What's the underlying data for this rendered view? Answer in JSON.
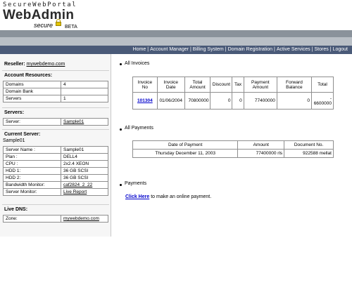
{
  "brand": {
    "top": "SecureWebPortal",
    "title": "WebAdmin",
    "secure": "secure",
    "beta": "BETA"
  },
  "nav": [
    "Home",
    "Account Manager",
    "Billing System",
    "Domain Registration",
    "Active Services",
    "Stores",
    "Logout"
  ],
  "sidebar": {
    "reseller_label": "Reseller:",
    "reseller_link": "mywebdemo.com",
    "resources_title": "Account Resources:",
    "resources": [
      {
        "k": "Domains",
        "v": "4"
      },
      {
        "k": "Domain Bank",
        "v": ""
      },
      {
        "k": "Servers",
        "v": "1"
      }
    ],
    "servers_title": "Servers:",
    "servers_row": {
      "k": "Server:",
      "v": "Sample01"
    },
    "current_title": "Current Server:",
    "current_name": "Sample01",
    "current": [
      {
        "k": "Server Name :",
        "v": "Sample01",
        "link": false
      },
      {
        "k": "Plan :",
        "v": "DELL4",
        "link": false
      },
      {
        "k": "CPU :",
        "v": "2x2.4 XEON",
        "link": false
      },
      {
        "k": "HDD 1:",
        "v": "36 GB SCSI",
        "link": false
      },
      {
        "k": "HDD 2:",
        "v": "36 GB SCSI",
        "link": false
      },
      {
        "k": "Bandwidth Monitor:",
        "v": "caf2824_2_22",
        "link": true
      },
      {
        "k": "Server Monitor:",
        "v": "Live Report",
        "link": true
      }
    ],
    "dns_title": "Live DNS:",
    "dns_row": {
      "k": "Zone:",
      "v": "mywebdemo.com"
    }
  },
  "invoices": {
    "title": "All Invoices",
    "headers": [
      "Invoice No",
      "Invoice Date",
      "Total Amount",
      "Discount",
      "Tax",
      "Payment Amount",
      "Forward Balance",
      "Total"
    ],
    "rows": [
      [
        "101304",
        "01/06/2004",
        "70800000",
        "0",
        "0",
        "77400000",
        "0",
        "- 6600000"
      ]
    ]
  },
  "payments": {
    "title": "All Payments",
    "headers": [
      "Date of Payment",
      "Amount",
      "Document No."
    ],
    "rows": [
      [
        "Thursday December 11, 2003",
        "77400000 rls",
        "922588 mellat"
      ]
    ]
  },
  "make_payment": {
    "title": "Payments",
    "link": "Click Here",
    "text": "to make an online payment."
  }
}
